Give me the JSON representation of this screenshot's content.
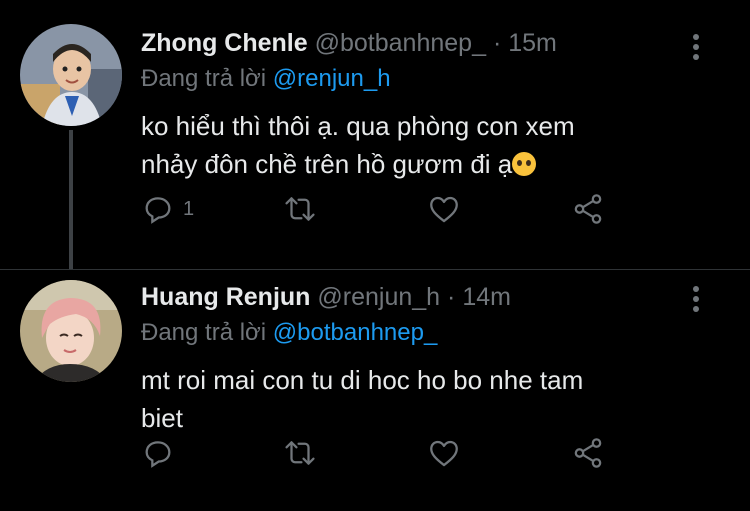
{
  "tweets": [
    {
      "name": "Zhong Chenle",
      "handle": "@botbanhnep_",
      "separator": "·",
      "time": "15m",
      "reply_prefix": "Đang trả lời",
      "reply_to": "@renjun_h",
      "text_lines": [
        "ko hiểu thì thôi ạ. qua phòng con xem",
        "nhảy đôn chề trên hồ gươm đi ạ"
      ],
      "reply_count": "1",
      "avatar_colors": {
        "bg": "#7a8aa0",
        "shirt": "#d8dce4",
        "face": "#e8c4a4"
      }
    },
    {
      "name": "Huang Renjun",
      "handle": "@renjun_h",
      "separator": "·",
      "time": "14m",
      "reply_prefix": "Đang trả lời",
      "reply_to": "@botbanhnep_",
      "text_lines": [
        "mt roi mai con tu di hoc ho bo nhe tam",
        "biet"
      ],
      "reply_count": "",
      "avatar_colors": {
        "bg": "#b7a47c",
        "hair": "#e8a6a2",
        "face": "#f3d6c6"
      }
    }
  ],
  "colors": {
    "background": "#000000",
    "text": "#e7e9ea",
    "secondary": "#71767b",
    "mention": "#1d9bf0"
  }
}
